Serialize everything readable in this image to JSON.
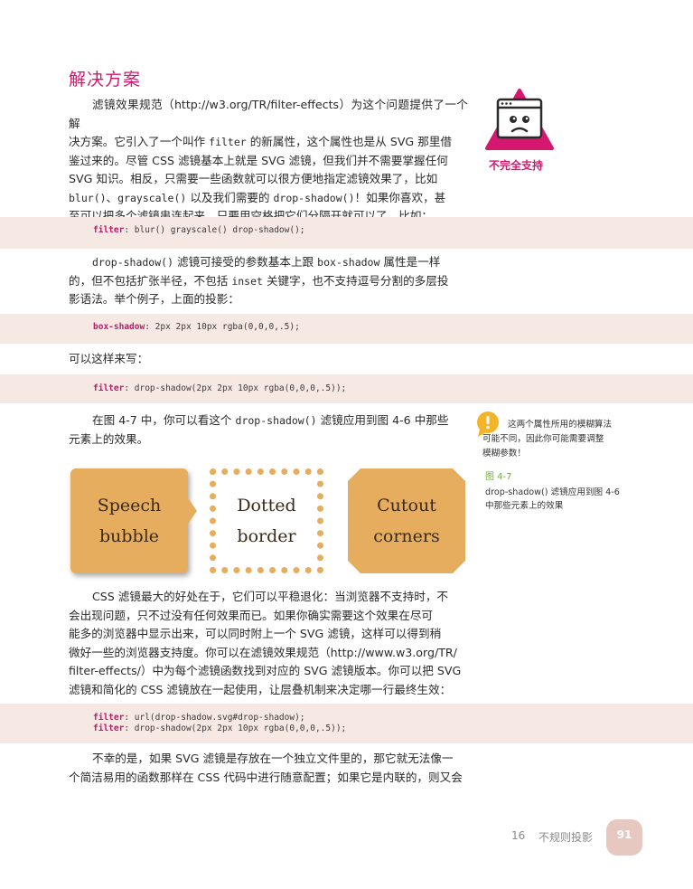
{
  "heading": "解决方案",
  "para1": {
    "l1": "滤镜效果规范（http://w3.org/TR/filter-effects）为这个问题提供了一个解",
    "l2a": "决方案。它引入了一个叫作 ",
    "l2code": "filter",
    "l2b": " 的新属性，这个属性也是从 SVG 那里借",
    "l3": "鉴过来的。尽管 CSS 滤镜基本上就是 SVG 滤镜，但我们并不需要掌握任何",
    "l4": "SVG 知识。相反，只需要一些函数就可以很方便地指定滤镜效果了，比如",
    "l5code1": "blur()",
    "l5a": "、",
    "l5code2": "grayscale()",
    "l5b": " 以及我们需要的 ",
    "l5code3": "drop-shadow()",
    "l5c": "！如果你喜欢，甚",
    "l6": "至可以把多个滤镜串连起来，只要用空格把它们分隔开就可以了，比如："
  },
  "code1": {
    "kw": "filter",
    "rest": ": blur() grayscale() drop-shadow();"
  },
  "para2": {
    "l1code": "drop-shadow()",
    "l1a": " 滤镜可接受的参数基本上跟 ",
    "l1code2": "box-shadow",
    "l1b": " 属性是一样",
    "l2a": "的，但不包括扩张半径，不包括 ",
    "l2code": "inset",
    "l2b": " 关键字，也不支持逗号分割的多层投",
    "l3": "影语法。举个例子，上面的投影："
  },
  "code2": {
    "kw": "box-shadow",
    "rest": ": 2px 2px 10px rgba(0,0,0,.5);"
  },
  "para3": "可以这样来写：",
  "code3": {
    "kw": "filter",
    "rest": ": drop-shadow(2px 2px 10px rgba(0,0,0,.5));"
  },
  "para4": {
    "l1a": "在图 4-7 中，你可以看这个 ",
    "l1code": "drop-shadow()",
    "l1b": " 滤镜应用到图 4-6 中那些",
    "l2": "元素上的效果。"
  },
  "figure": {
    "box1": [
      "Speech",
      "bubble"
    ],
    "box2": [
      "Dotted",
      "border"
    ],
    "box3": [
      "Cutout",
      "corners"
    ]
  },
  "para5": {
    "l1": "CSS 滤镜最大的好处在于，它们可以平稳退化：当浏览器不支持时，不",
    "l2": "会出现问题，只不过没有任何效果而已。如果你确实需要这个效果在尽可",
    "l3": "能多的浏览器中显示出来，可以同时附上一个 SVG 滤镜，这样可以得到稍",
    "l4": "微好一些的浏览器支持度。你可以在滤镜效果规范（http://www.w3.org/TR/",
    "l5": "filter-effects/）中为每个滤镜函数找到对应的 SVG 滤镜版本。你可以把 SVG",
    "l6": "滤镜和简化的 CSS 滤镜放在一起使用，让层叠机制来决定哪一行最终生效："
  },
  "code4": {
    "line1kw": "filter",
    "line1rest": ": url(drop-shadow.svg#drop-shadow);",
    "line2kw": "filter",
    "line2rest": ": drop-shadow(2px 2px 10px rgba(0,0,0,.5));"
  },
  "para6": {
    "l1": "不幸的是，如果 SVG 滤镜是存放在一个独立文件里的，那它就无法像一",
    "l2": "个简洁易用的函数那样在 CSS 代码中进行随意配置；如果它是内联的，则又会"
  },
  "badge": {
    "label": "不完全支持",
    "color": "#d4186f"
  },
  "note": {
    "line1": "这两个属性所用的模糊算法",
    "line2": "可能不同，因此你可能需要调整",
    "line3": "模糊参数！",
    "icon_color": "#f2b52a"
  },
  "figure_caption": {
    "label": "图 4-7",
    "line1": "drop-shadow() 滤镜应用到图 4-6",
    "line2": "中那些元素上的效果"
  },
  "footer": {
    "chapter_num": "16",
    "chapter_title": "不规则投影",
    "page": "91"
  }
}
